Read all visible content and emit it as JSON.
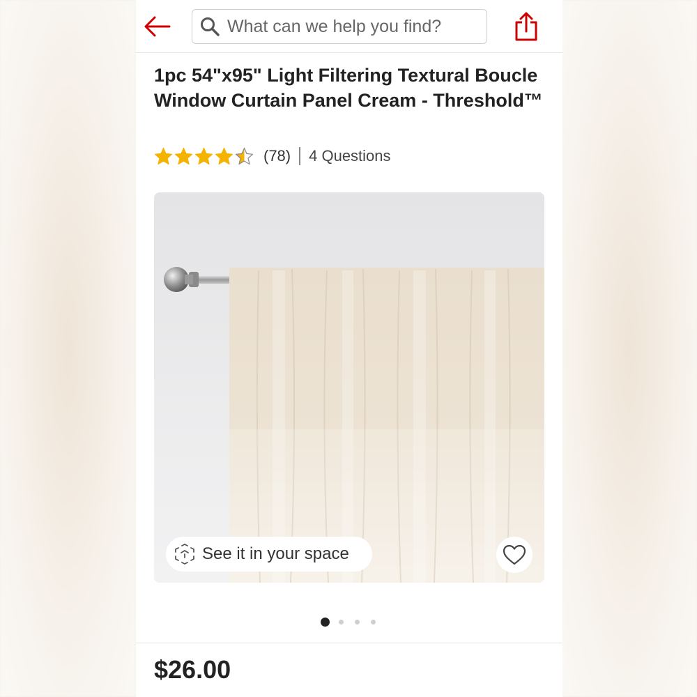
{
  "search": {
    "placeholder": "What can we help you find?"
  },
  "product": {
    "title": "1pc 54\"x95\" Light Filtering Textural Boucle Window Curtain Panel Cream - Threshold™",
    "rating": 4.5,
    "rating_max": 5,
    "review_count": "(78)",
    "questions": "4 Questions",
    "price": "$26.00"
  },
  "gallery": {
    "see_in_space": "See it in your space",
    "slide_count": 4,
    "active_slide": 1
  },
  "colors": {
    "accent": "#cc0000",
    "star": "#f5b301"
  },
  "icons": {
    "back": "arrow-left-icon",
    "search": "search-icon",
    "share": "share-icon",
    "ar": "ar-cube-icon",
    "favorite": "heart-icon",
    "star": "star-icon"
  }
}
